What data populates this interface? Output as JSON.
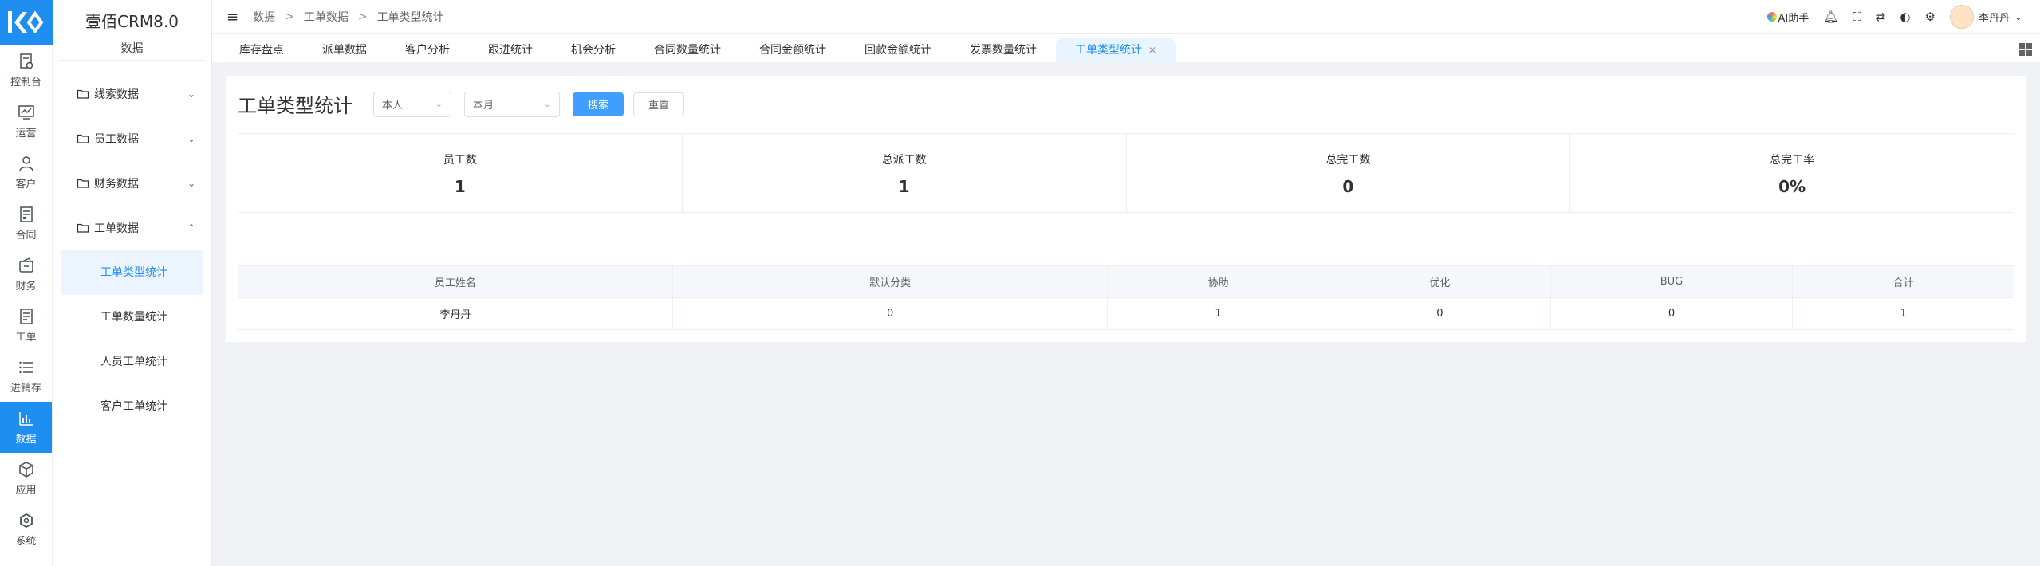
{
  "rail": {
    "items": [
      {
        "label": "控制台",
        "icon": "dashboard-icon"
      },
      {
        "label": "运营",
        "icon": "chart-line-icon"
      },
      {
        "label": "客户",
        "icon": "user-icon"
      },
      {
        "label": "合同",
        "icon": "contract-icon"
      },
      {
        "label": "财务",
        "icon": "wallet-icon"
      },
      {
        "label": "工单",
        "icon": "ticket-icon"
      },
      {
        "label": "进销存",
        "icon": "list-icon"
      },
      {
        "label": "数据",
        "icon": "bar-chart-icon"
      },
      {
        "label": "应用",
        "icon": "cube-icon"
      },
      {
        "label": "系统",
        "icon": "hexagon-icon"
      }
    ]
  },
  "sidebar": {
    "brand": "壹佰CRM8.0",
    "section": "数据",
    "groups": [
      {
        "label": "线索数据"
      },
      {
        "label": "员工数据"
      },
      {
        "label": "财务数据"
      },
      {
        "label": "工单数据"
      }
    ],
    "subitems": [
      {
        "label": "工单类型统计"
      },
      {
        "label": "工单数量统计"
      },
      {
        "label": "人员工单统计"
      },
      {
        "label": "客户工单统计"
      }
    ]
  },
  "topbar": {
    "breadcrumb": [
      "数据",
      "工单数据",
      "工单类型统计"
    ],
    "ai_label": "AI助手",
    "user_name": "李丹丹"
  },
  "tabs": [
    {
      "label": "库存盘点"
    },
    {
      "label": "派单数据"
    },
    {
      "label": "客户分析"
    },
    {
      "label": "跟进统计"
    },
    {
      "label": "机会分析"
    },
    {
      "label": "合同数量统计"
    },
    {
      "label": "合同金额统计"
    },
    {
      "label": "回款金额统计"
    },
    {
      "label": "发票数量统计"
    },
    {
      "label": "工单类型统计"
    }
  ],
  "main": {
    "title": "工单类型统计",
    "filter_person": "本人",
    "filter_period": "本月",
    "search_label": "搜索",
    "reset_label": "重置",
    "stats": [
      {
        "label": "员工数",
        "value": "1"
      },
      {
        "label": "总派工数",
        "value": "1"
      },
      {
        "label": "总完工数",
        "value": "0"
      },
      {
        "label": "总完工率",
        "value": "0%"
      }
    ],
    "table": {
      "headers": [
        "员工姓名",
        "默认分类",
        "协助",
        "优化",
        "BUG",
        "合计"
      ],
      "rows": [
        [
          "李丹丹",
          "0",
          "1",
          "0",
          "0",
          "1"
        ]
      ]
    }
  },
  "colors": {
    "accent": "#1f8ef1",
    "button_primary": "#409eff",
    "active_tab_bg": "#e8f4ff"
  }
}
